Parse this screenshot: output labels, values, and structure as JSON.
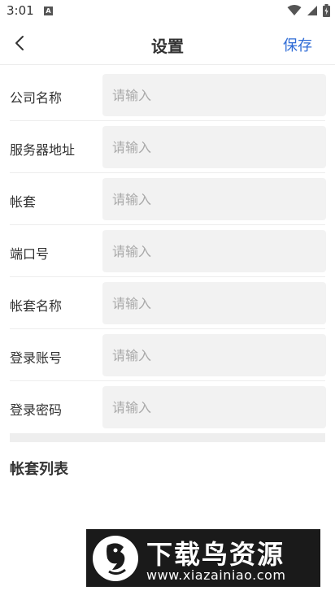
{
  "status_bar": {
    "time": "3:01",
    "notification_icon_letter": "A",
    "icons": [
      "wifi-icon",
      "signal-icon",
      "battery-icon"
    ]
  },
  "appbar": {
    "back_icon": "chevron-left-icon",
    "title": "设置",
    "save_label": "保存",
    "accent_color": "#2f6cd6"
  },
  "form": {
    "fields": [
      {
        "label": "公司名称",
        "placeholder": "请输入",
        "value": ""
      },
      {
        "label": "服务器地址",
        "placeholder": "请输入",
        "value": ""
      },
      {
        "label": "帐套",
        "placeholder": "请输入",
        "value": ""
      },
      {
        "label": "端口号",
        "placeholder": "请输入",
        "value": ""
      },
      {
        "label": "帐套名称",
        "placeholder": "请输入",
        "value": ""
      },
      {
        "label": "登录账号",
        "placeholder": "请输入",
        "value": ""
      },
      {
        "label": "登录密码",
        "placeholder": "请输入",
        "value": ""
      }
    ]
  },
  "section": {
    "title": "帐套列表"
  },
  "watermark": {
    "title": "下载鸟资源",
    "url": "www.xiazainiao.com"
  }
}
